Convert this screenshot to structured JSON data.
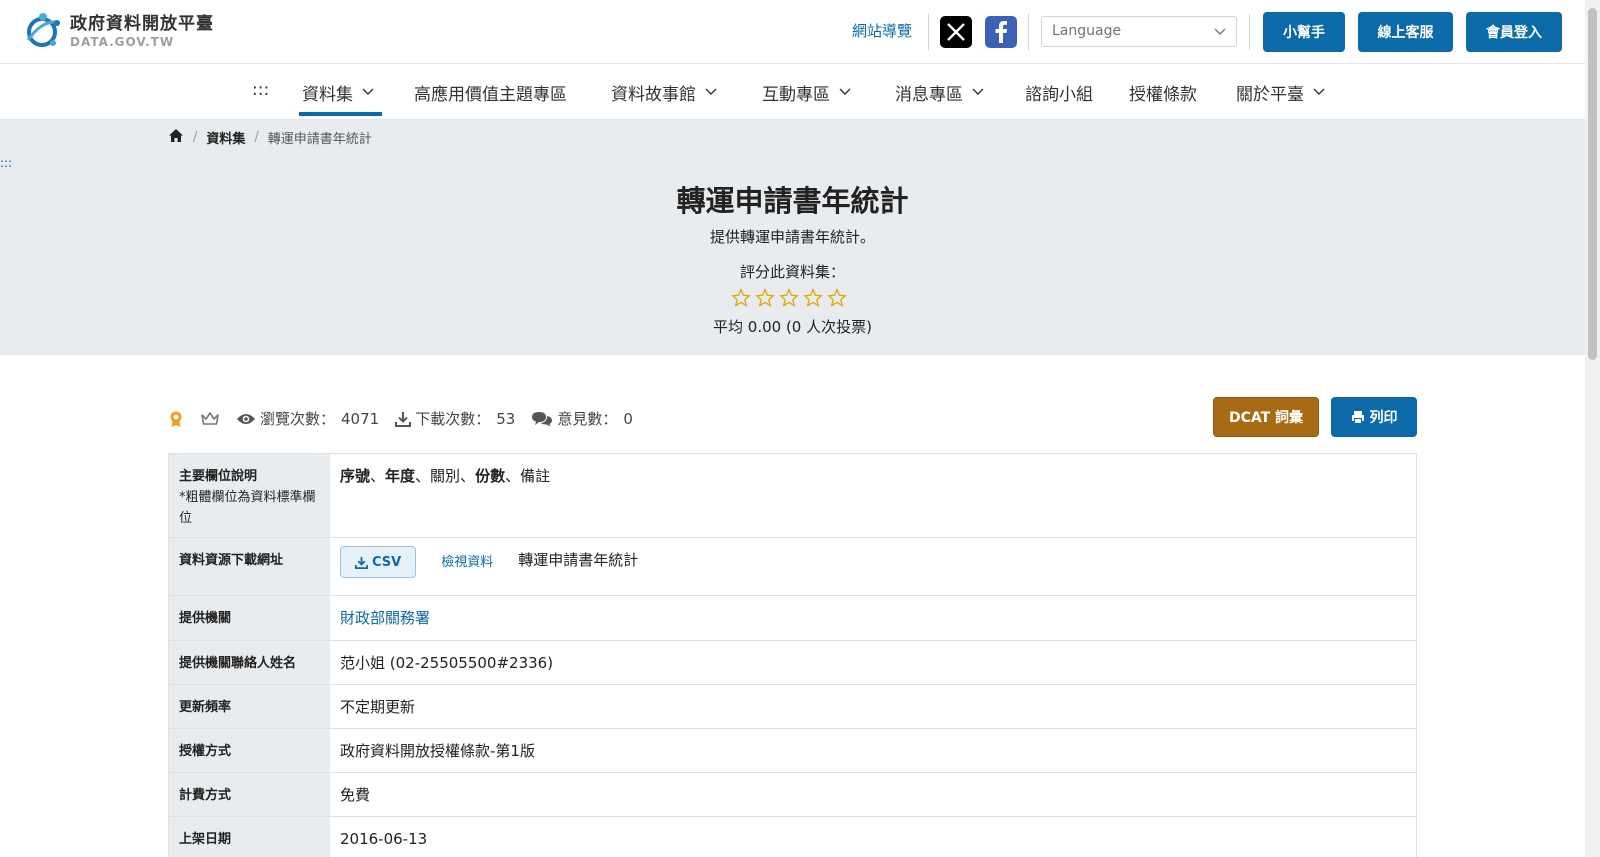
{
  "header": {
    "logo_title": "政府資料開放平臺",
    "logo_sub": "DATA.GOV.TW",
    "site_nav": "網站導覽",
    "language_placeholder": "Language",
    "buttons": {
      "helper": "小幫手",
      "support": "線上客服",
      "login": "會員登入"
    }
  },
  "nav": {
    "skip": ":::",
    "items": [
      {
        "label": "資料集",
        "dropdown": true,
        "active": true
      },
      {
        "label": "高應用價值主題專區",
        "dropdown": false
      },
      {
        "label": "資料故事館",
        "dropdown": true
      },
      {
        "label": "互動專區",
        "dropdown": true
      },
      {
        "label": "消息專區",
        "dropdown": true
      },
      {
        "label": "諮詢小組",
        "dropdown": false
      },
      {
        "label": "授權條款",
        "dropdown": false
      },
      {
        "label": "關於平臺",
        "dropdown": true
      }
    ]
  },
  "breadcrumb": {
    "section": "資料集",
    "current": "轉運申請書年統計"
  },
  "hero": {
    "skip": ":::",
    "title": "轉運申請書年統計",
    "description": "提供轉運申請書年統計。",
    "rate_label": "評分此資料集：",
    "rating": 0,
    "rating_max": 5,
    "average": "平均 0.00 (0 人次投票)"
  },
  "stats": {
    "views_label": "瀏覽次數：",
    "views": "4071",
    "downloads_label": "下載次數：",
    "downloads": "53",
    "comments_label": "意見數：",
    "comments": "0"
  },
  "actions": {
    "dcat": "DCAT 詞彙",
    "print": "列印"
  },
  "info": {
    "fields_label": "主要欄位說明",
    "fields_note": "*粗體欄位為資料標準欄位",
    "fields": [
      {
        "text": "序號",
        "bold": true
      },
      {
        "text": "、",
        "bold": false
      },
      {
        "text": "年度",
        "bold": true
      },
      {
        "text": "、關別、",
        "bold": false
      },
      {
        "text": "份數",
        "bold": true
      },
      {
        "text": "、備註",
        "bold": false
      }
    ],
    "resource_label": "資料資源下載網址",
    "resource_format": "CSV",
    "resource_view": "檢視資料",
    "resource_name": "轉運申請書年統計",
    "provider_label": "提供機關",
    "provider": "財政部關務署",
    "contact_label": "提供機關聯絡人姓名",
    "contact": "范小姐 (02-25505500#2336)",
    "frequency_label": "更新頻率",
    "frequency": "不定期更新",
    "license_label": "授權方式",
    "license": "政府資料開放授權條款-第1版",
    "fee_label": "計費方式",
    "fee": "免費",
    "published_label": "上架日期",
    "published": "2016-06-13"
  },
  "colors": {
    "primary": "#0d6aa8",
    "dcat": "#a86b14",
    "hero_bg": "#e9ecef",
    "star": "#e0a800"
  }
}
